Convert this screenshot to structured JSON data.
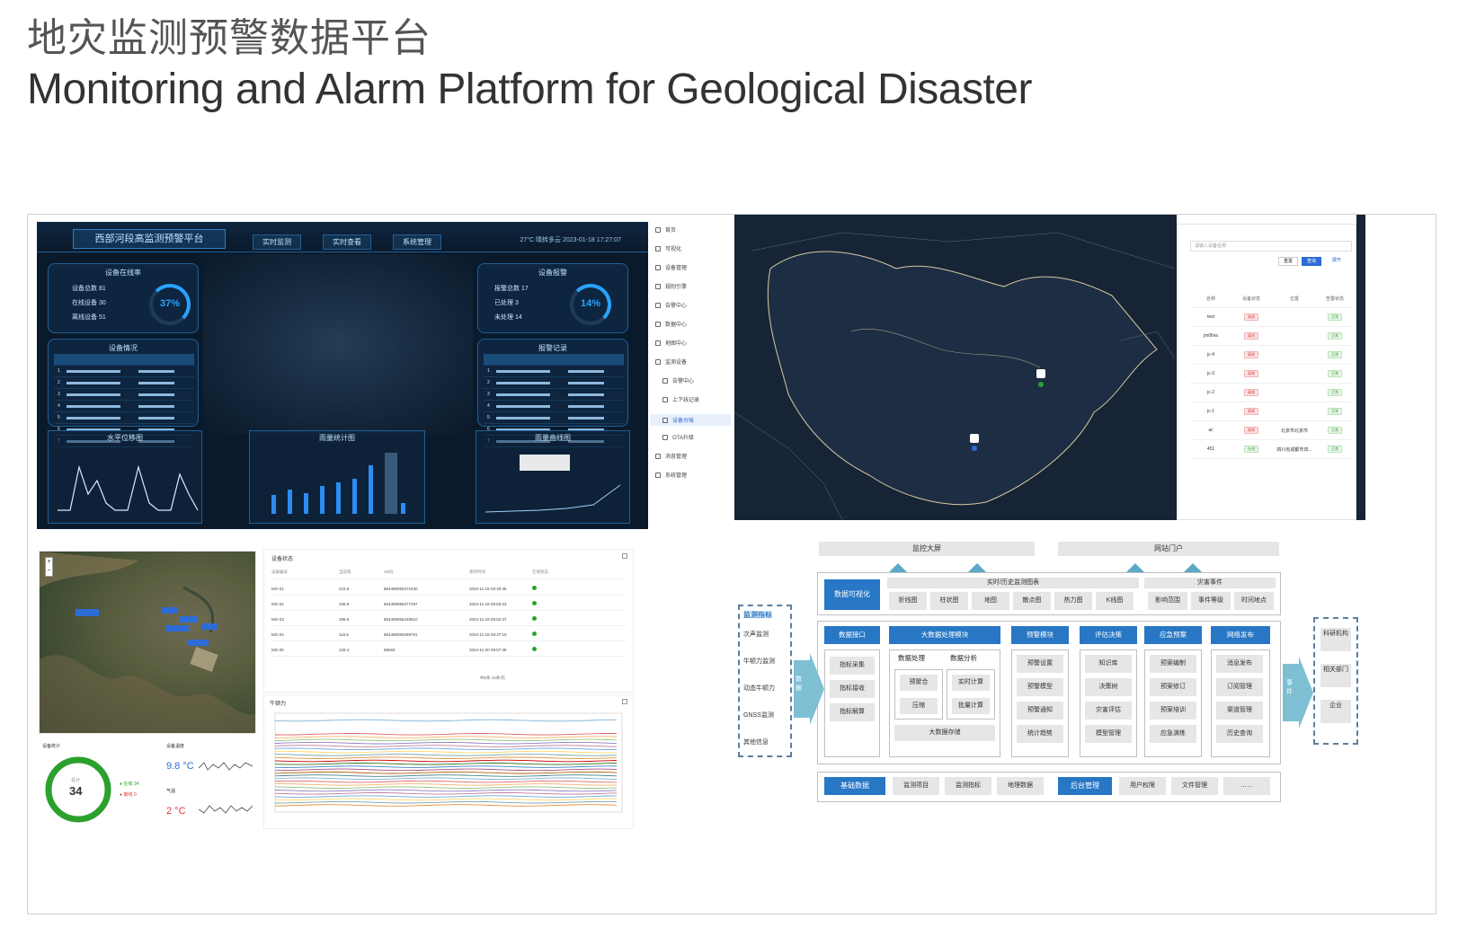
{
  "header": {
    "title_cn": "地灾监测预警数据平台",
    "title_en": "Monitoring and Alarm Platform for Geological Disaster"
  },
  "dashboard": {
    "title": "西部河段高监测预警平台",
    "tabs": [
      "实时监测",
      "实时查看",
      "系统管理"
    ],
    "status_line": "27°C  晴转多云   2023-01-18 17:27:07",
    "device_online": {
      "title": "设备在线率",
      "total": "81",
      "online": "30",
      "offline": "51",
      "percent": "37%"
    },
    "device_alarm": {
      "title": "设备报警",
      "total": "17",
      "processed": "3",
      "unprocessed": "14",
      "percent": "14%"
    },
    "device_status_title": "设备情况",
    "alarm_record_title": "报警记录",
    "horizontal_title": "水平位移图",
    "bar_title": "雨量统计图",
    "curve_title": "雨量曲线图",
    "device_rows": [
      "1",
      "2",
      "3",
      "4",
      "5",
      "6",
      "7"
    ],
    "alarm_rows": [
      "1",
      "2",
      "3",
      "4",
      "5",
      "6",
      "7"
    ],
    "bar_values": [
      22,
      28,
      24,
      32,
      36,
      40,
      55,
      70,
      12
    ]
  },
  "sidebar": {
    "items": [
      "首页",
      "可视化",
      "设备管理",
      "规则引擎",
      "告警中心",
      "数据中心",
      "地图中心",
      "监测设备",
      "告警中心",
      "上下线记录",
      "设备台账",
      "OTA升级",
      "消息管理",
      "系统管理"
    ],
    "selected_index": 10
  },
  "device_table": {
    "search_placeholder": "请输入设备名称",
    "buttons": [
      "查询",
      "重置",
      "展开"
    ],
    "columns": [
      "名称",
      "设备状态",
      "位置",
      "告警状态"
    ],
    "rows": [
      {
        "name": "test",
        "status": "离线",
        "location": "",
        "alarm": "正常"
      },
      {
        "name": "jm0fvia",
        "status": "离线",
        "location": "",
        "alarm": "正常"
      },
      {
        "name": "jc-4",
        "status": "离线",
        "location": "",
        "alarm": "正常"
      },
      {
        "name": "jc-3",
        "status": "离线",
        "location": "",
        "alarm": "正常"
      },
      {
        "name": "jc-2",
        "status": "离线",
        "location": "",
        "alarm": "正常"
      },
      {
        "name": "jc-1",
        "status": "离线",
        "location": "",
        "alarm": "正常"
      },
      {
        "name": "ac",
        "status": "离线",
        "location": "北京市北京市",
        "alarm": "正常"
      },
      {
        "name": "451",
        "status": "在线",
        "location": "四川省成都市双...",
        "alarm": "正常"
      }
    ]
  },
  "monitor_table": {
    "title": "设备状态",
    "columns": [
      "设备编号",
      "当前值",
      "SN码",
      "更新时间",
      "在线状态"
    ],
    "rows": [
      {
        "id": "MG-01",
        "value": "215.6",
        "sn": "864498058371840",
        "time": "2024-11-15 09:40:46"
      },
      {
        "id": "MG-02",
        "value": "108.9",
        "sn": "864499058477297",
        "time": "2024-11-18 09:53:33"
      },
      {
        "id": "MG-03",
        "value": "398.6",
        "sn": "864499058449510",
        "time": "2024-11-18 09:52:37"
      },
      {
        "id": "MG-04",
        "value": "116.5",
        "sn": "864499058499791",
        "time": "2024-11-18 09:47:15"
      },
      {
        "id": "MG-05",
        "value": "128.4",
        "sn": "86583",
        "time": "2024-11-20 09:57:38"
      }
    ],
    "pagination": "共5条  10条/页"
  },
  "line_chart": {
    "title": "牛顿力"
  },
  "device_stats": {
    "title": "设备统计",
    "total_label": "总计",
    "total": "34",
    "online_label": "在线",
    "online": "34",
    "offline_label": "离线",
    "offline": "0"
  },
  "weather": {
    "temp_label": "设备温度",
    "temp": "9.8 °C",
    "air_label": "气温",
    "air": "2 °C"
  },
  "architecture": {
    "top_left": "监控大屏",
    "top_right": "网站门户",
    "visual": "数据可视化",
    "realtime": "实时/历史监测图表",
    "disaster_events": "灾害事件",
    "chart_types": [
      "折线图",
      "柱状图",
      "地图",
      "散点图",
      "热力图",
      "K线图"
    ],
    "event_types": [
      "影响范围",
      "事件等级",
      "时间地点"
    ],
    "left_title": "监测指标",
    "left_items": [
      "次声监测",
      "牛顿力监测",
      "动态牛顿力",
      "GNSS监测",
      "其他信息"
    ],
    "modules": [
      "数据接口",
      "大数据处理模块",
      "预警模块",
      "评估决策",
      "应急预案",
      "网络发布"
    ],
    "interface_items": [
      "指标采集",
      "指标接收",
      "指标解算"
    ],
    "bigdata_left": "数据处理",
    "bigdata_right": "数据分析",
    "bigdata_sub": [
      "预聚合",
      "压缩",
      "实时计算",
      "批量计算"
    ],
    "bigdata_store": "大数据存储",
    "warn_items": [
      "预警设置",
      "预警模型",
      "预警通知",
      "统计趋势"
    ],
    "eval_items": [
      "知识库",
      "决策树",
      "灾害评估",
      "模型管理"
    ],
    "plan_items": [
      "预案编制",
      "预案修订",
      "预案培训",
      "应急演练"
    ],
    "pub_items": [
      "消息发布",
      "订阅管理",
      "渠道管理",
      "历史查询"
    ],
    "base": "基础数据",
    "base_items": [
      "监测项目",
      "监测指标",
      "地理数据"
    ],
    "backend": "后台管理",
    "backend_items": [
      "用户权限",
      "文件管理",
      "……"
    ],
    "arrow_in": "数据",
    "arrow_out": "事件",
    "right_items": [
      "科研机构",
      "相关部门",
      "企业"
    ]
  },
  "colors": {
    "dark_bg": "#0b1a2b",
    "accent_blue": "#2877c5",
    "online_green": "#2ca02c"
  }
}
